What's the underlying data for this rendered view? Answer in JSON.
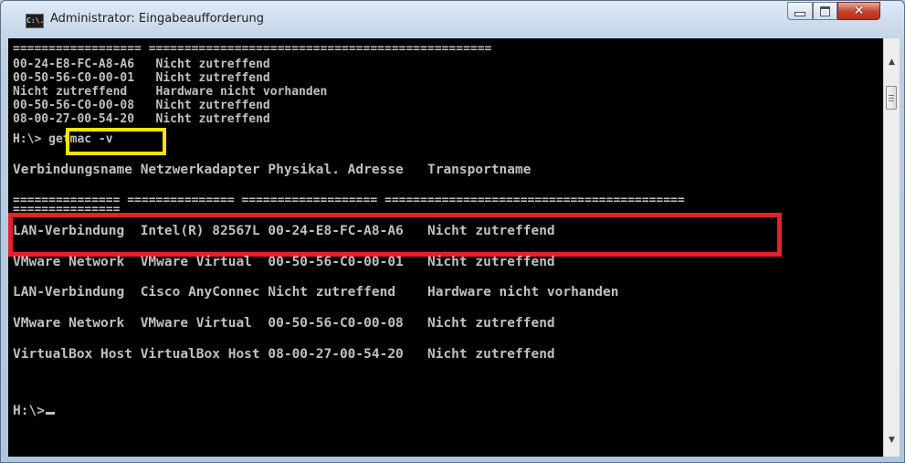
{
  "window": {
    "title": "Administrator: Eingabeaufforderung",
    "icon_text": "C:\\."
  },
  "console": {
    "upper_lines": [
      "================== ================================================",
      "00-24-E8-FC-A8-A6   Nicht zutreffend",
      "00-50-56-C0-00-01   Nicht zutreffend",
      "Nicht zutreffend    Hardware nicht vorhanden",
      "00-50-56-C0-00-08   Nicht zutreffend",
      "08-00-27-00-54-20   Nicht zutreffend"
    ],
    "prompt": "H:\\>",
    "command": "getmac -v",
    "table": {
      "headers": [
        "Verbindungsname",
        "Netzwerkadapter",
        "Physikal. Adresse",
        "Transportname"
      ],
      "separator": "=============== =============== =================== ==========================================",
      "separator_tail": "===============",
      "rows": [
        [
          "LAN-Verbindung",
          "Intel(R) 82567L",
          "00-24-E8-FC-A8-A6",
          "Nicht zutreffend"
        ],
        [
          "VMware Network",
          "VMware Virtual",
          "00-50-56-C0-00-01",
          "Nicht zutreffend"
        ],
        [
          "LAN-Verbindung",
          "Cisco AnyConnec",
          "Nicht zutreffend",
          "Hardware nicht vorhanden"
        ],
        [
          "VMware Network",
          "VMware Virtual",
          "00-50-56-C0-00-08",
          "Nicht zutreffend"
        ],
        [
          "VirtualBox Host",
          "VirtualBox Host",
          "08-00-27-00-54-20",
          "Nicht zutreffend"
        ]
      ]
    },
    "final_prompt": "H:\\>"
  },
  "colors": {
    "console_bg": "#000000",
    "console_fg": "#c0c0c0",
    "highlight_command": "#f5e500",
    "highlight_row": "#e3222b"
  },
  "icons": [
    "cmd-icon",
    "minimize-icon",
    "maximize-icon",
    "close-icon",
    "scroll-up-icon",
    "scroll-down-icon"
  ]
}
